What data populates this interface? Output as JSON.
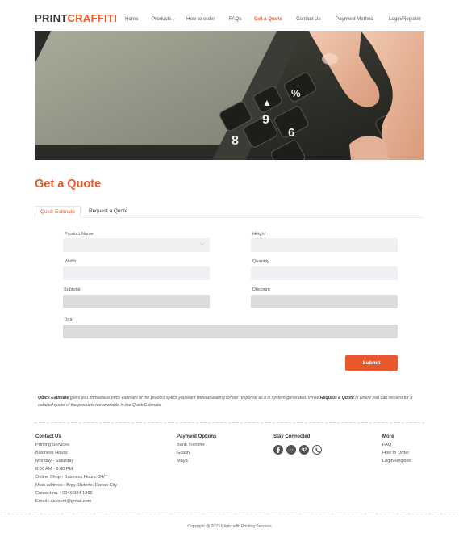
{
  "brand": {
    "part1": "PRINT",
    "part2": "CRAFFITI",
    "primary_color": "#3a3a3a",
    "accent_color": "#e8582a"
  },
  "nav": {
    "items": [
      {
        "label": "Home"
      },
      {
        "label": "Products"
      },
      {
        "label": "How to order"
      },
      {
        "label": "FAQs"
      },
      {
        "label": "Get a Quote"
      },
      {
        "label": "Contact Us"
      },
      {
        "label": "Payment Method"
      },
      {
        "label": "Login/Register"
      }
    ],
    "active": "Get a Quote"
  },
  "page": {
    "title": "Get a Quote"
  },
  "tabs": [
    {
      "label": "Quick Estimate",
      "active": true
    },
    {
      "label": "Request a Quote",
      "active": false
    }
  ],
  "form": {
    "product_name": {
      "label": "Product Name",
      "value": ""
    },
    "height": {
      "label": "Height",
      "value": ""
    },
    "width": {
      "label": "Width",
      "value": ""
    },
    "quantity": {
      "label": "Quantity",
      "value": ""
    },
    "subtotal": {
      "label": "Subtotal",
      "value": ""
    },
    "discount": {
      "label": "Discount",
      "value": ""
    },
    "total": {
      "label": "Total",
      "value": ""
    },
    "submit_label": "Submit"
  },
  "note": {
    "term1": "Quick Estimate",
    "text1": " gives you immediace price estimate of the product specs you want without waiting for our response as it is system-generated. While ",
    "term2": "Request a Quote",
    "text2": " is where you can request for a detailed quote of the products not available in the Quick Estimate."
  },
  "footer": {
    "contact": {
      "heading": "Contact Us",
      "lines": [
        "Printing Services",
        "Business Hours:",
        "Monday - Saturday",
        "8:00 AM - 6:00 PM",
        "Online Shop - Business Hours: 24/7",
        "Main address : Brgy. Duterte, Davao City",
        "Contact no. : 0946 934 1996",
        "Email : account@gmail.com"
      ]
    },
    "payment": {
      "heading": "Payment Options",
      "lines": [
        "Bank Transfer",
        "Gcash",
        "Maya"
      ]
    },
    "social": {
      "heading": "Stay Connected",
      "icons": [
        "facebook-icon",
        "messenger-icon",
        "pinterest-icon",
        "viber-icon"
      ]
    },
    "more": {
      "heading": "More",
      "lines": [
        "FAQ",
        "How to Order",
        "Login/Register"
      ]
    },
    "copyright": "Copyright @ 2023 Printcraffiti Printing Services"
  }
}
